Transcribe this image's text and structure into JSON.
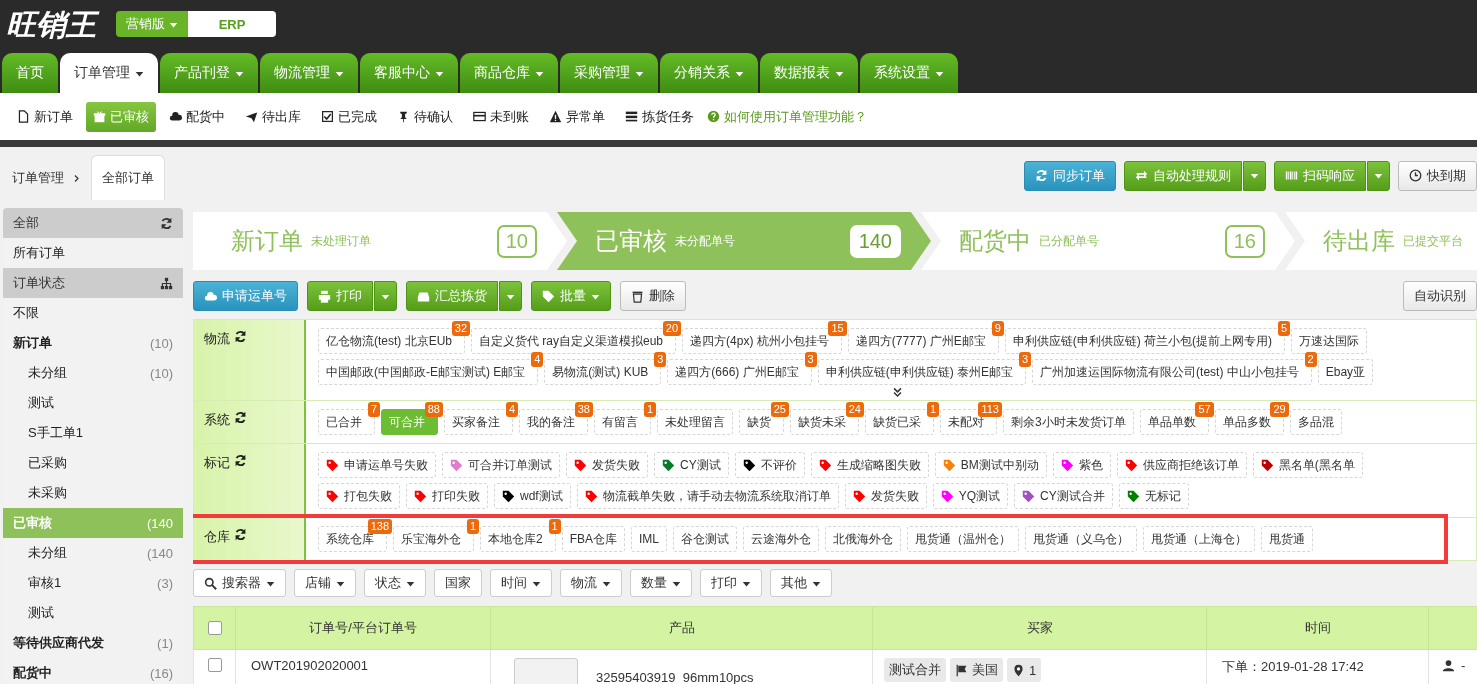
{
  "app": {
    "logo": "旺销王",
    "editions": [
      {
        "label": "营销版",
        "dropdown": true,
        "selected": false
      },
      {
        "label": "ERP",
        "dropdown": false,
        "selected": true
      }
    ]
  },
  "nav_tabs": [
    {
      "label": "首页",
      "dropdown": false,
      "selected": false
    },
    {
      "label": "订单管理",
      "dropdown": true,
      "selected": true
    },
    {
      "label": "产品刊登",
      "dropdown": true,
      "selected": false
    },
    {
      "label": "物流管理",
      "dropdown": true,
      "selected": false
    },
    {
      "label": "客服中心",
      "dropdown": true,
      "selected": false
    },
    {
      "label": "商品仓库",
      "dropdown": true,
      "selected": false
    },
    {
      "label": "采购管理",
      "dropdown": true,
      "selected": false
    },
    {
      "label": "分销关系",
      "dropdown": true,
      "selected": false
    },
    {
      "label": "数据报表",
      "dropdown": true,
      "selected": false
    },
    {
      "label": "系统设置",
      "dropdown": true,
      "selected": false
    }
  ],
  "sub_nav": {
    "items": [
      {
        "label": "新订单",
        "selected": false
      },
      {
        "label": "已审核",
        "selected": true
      },
      {
        "label": "配货中",
        "selected": false
      },
      {
        "label": "待出库",
        "selected": false
      },
      {
        "label": "已完成",
        "selected": false
      },
      {
        "label": "待确认",
        "selected": false
      },
      {
        "label": "未到账",
        "selected": false
      },
      {
        "label": "异常单",
        "selected": false
      },
      {
        "label": "拣货任务",
        "selected": false
      }
    ],
    "help_link": "如何使用订单管理功能？"
  },
  "breadcrumb": {
    "root": "订单管理",
    "tab": "全部订单"
  },
  "toolbar": [
    {
      "label": "同步订单",
      "kind": "info"
    },
    {
      "label": "自动处理规则",
      "kind": "split"
    },
    {
      "label": "扫码响应",
      "kind": "split"
    },
    {
      "label": "快到期",
      "kind": "plain"
    }
  ],
  "sidebar": {
    "sections": [
      {
        "title": "全部",
        "items": [
          {
            "label": "所有订单",
            "kind": "plain",
            "selected": false
          }
        ]
      },
      {
        "title": "订单状态",
        "items": [
          {
            "label": "不限",
            "kind": "plain",
            "selected": false
          },
          {
            "label": "新订单",
            "kind": "status",
            "count": "(10)",
            "selected": false,
            "children": [
              {
                "label": "未分组",
                "count": "(10)",
                "selected": false
              },
              {
                "label": "测试",
                "selected": false
              },
              {
                "label": "S手工单1",
                "selected": false
              },
              {
                "label": "已采购",
                "selected": false
              },
              {
                "label": "未采购",
                "selected": false
              }
            ]
          },
          {
            "label": "已审核",
            "kind": "status",
            "count": "(140",
            "selected": true,
            "children": [
              {
                "label": "未分组",
                "count": "(140",
                "selected": false
              },
              {
                "label": "审核1",
                "count": "(3)",
                "selected": false
              },
              {
                "label": "测试",
                "selected": false
              }
            ]
          },
          {
            "label": "等待供应商代发",
            "kind": "status",
            "count": "(1)",
            "selected": false
          },
          {
            "label": "配货中",
            "kind": "status",
            "count": "(16)",
            "selected": false
          }
        ]
      }
    ]
  },
  "pipeline": [
    {
      "title": "新订单",
      "subtitle": "未处理订单",
      "count": "10",
      "selected": false
    },
    {
      "title": "已审核",
      "subtitle": "未分配单号",
      "count": "140",
      "selected": true
    },
    {
      "title": "配货中",
      "subtitle": "已分配单号",
      "count": "16",
      "selected": false
    },
    {
      "title": "待出库",
      "subtitle": "已提交平台",
      "selected": false
    }
  ],
  "actions": [
    {
      "label": "申请运单号",
      "kind": "info"
    },
    {
      "label": "打印",
      "kind": "split"
    },
    {
      "label": "汇总拣货",
      "kind": "split"
    },
    {
      "label": "批量",
      "kind": "dropdown"
    },
    {
      "label": "删除",
      "kind": "plain"
    }
  ],
  "actions_right": "自动识别",
  "filters": [
    {
      "label": "物流",
      "kind": "chips",
      "expandable": true,
      "highlighted": false,
      "lines": [
        [
          {
            "label": "亿仓物流(test) 北京EUb",
            "count": "32",
            "selected": false
          },
          {
            "label": "自定义货代 ray自定义渠道模拟eub",
            "count": "20",
            "selected": false
          },
          {
            "label": "递四方(4px) 杭州小包挂号",
            "count": "15",
            "selected": false
          },
          {
            "label": "递四方(7777) 广州E邮宝",
            "count": "9",
            "selected": false
          },
          {
            "label": "申利供应链(申利供应链) 荷兰小包(提前上网专用)",
            "count": "5",
            "selected": false
          },
          {
            "label": "万速达国际",
            "selected": false
          }
        ],
        [
          {
            "label": "中国邮政(中国邮政-E邮宝测试) E邮宝",
            "count": "4",
            "selected": false
          },
          {
            "label": "易物流(测试) KUB",
            "count": "3",
            "selected": false
          },
          {
            "label": "递四方(666) 广州E邮宝",
            "count": "3",
            "selected": false
          },
          {
            "label": "申利供应链(申利供应链) 泰州E邮宝",
            "count": "3",
            "selected": false
          },
          {
            "label": "广州加速运国际物流有限公司(test) 中山小包挂号",
            "count": "2",
            "selected": false
          },
          {
            "label": "Ebay亚",
            "selected": false
          }
        ]
      ]
    },
    {
      "label": "系统",
      "kind": "chips",
      "expandable": false,
      "highlighted": false,
      "lines": [
        [
          {
            "label": "已合并",
            "count": "7",
            "selected": false
          },
          {
            "label": "可合并",
            "count": "88",
            "selected": true
          },
          {
            "label": "买家备注",
            "count": "4",
            "selected": false
          },
          {
            "label": "我的备注",
            "count": "38",
            "selected": false
          },
          {
            "label": "有留言",
            "count": "1",
            "selected": false
          },
          {
            "label": "未处理留言",
            "selected": false
          },
          {
            "label": "缺货",
            "count": "25",
            "selected": false
          },
          {
            "label": "缺货未采",
            "count": "24",
            "selected": false
          },
          {
            "label": "缺货已采",
            "count": "1",
            "selected": false
          },
          {
            "label": "未配对",
            "count": "113",
            "selected": false
          },
          {
            "label": "剩余3小时未发货订单",
            "selected": false
          },
          {
            "label": "单品单数",
            "count": "57",
            "selected": false
          },
          {
            "label": "单品多数",
            "count": "29",
            "selected": false
          },
          {
            "label": "多品混",
            "selected": false
          }
        ]
      ]
    },
    {
      "label": "标记",
      "kind": "tags",
      "expandable": false,
      "highlighted": false,
      "lines": [
        [
          {
            "label": "申请运单号失败",
            "color": "#ff0000",
            "selected": false
          },
          {
            "label": "可合并订单测试",
            "color": "#e07bd0",
            "selected": false
          },
          {
            "label": "发货失败",
            "color": "#ff0000",
            "selected": false
          },
          {
            "label": "CY测试",
            "color": "#0a7a2a",
            "selected": false
          },
          {
            "label": "不评价",
            "color": "#000000",
            "selected": false
          },
          {
            "label": "生成缩略图失败",
            "color": "#ff0000",
            "selected": false
          },
          {
            "label": "BM测试中别动",
            "color": "#ff7f00",
            "selected": false
          },
          {
            "label": "紫色",
            "color": "#ff00ff",
            "selected": false
          },
          {
            "label": "供应商拒绝该订单",
            "color": "#ff0000",
            "selected": false
          },
          {
            "label": "黑名单(黑名单",
            "color": "#c00000",
            "selected": false
          }
        ],
        [
          {
            "label": "打包失败",
            "color": "#ff0000",
            "selected": false
          },
          {
            "label": "打印失败",
            "color": "#ff0000",
            "selected": false
          },
          {
            "label": "wdf测试",
            "color": "#000000",
            "selected": false
          },
          {
            "label": "物流截单失败，请手动去物流系统取消订单",
            "color": "#ff0000",
            "selected": false
          },
          {
            "label": "发货失败",
            "color": "#ff0000",
            "selected": false
          },
          {
            "label": "YQ测试",
            "color": "#ff00ff",
            "selected": false
          },
          {
            "label": "CY测试合并",
            "color": "#a050c0",
            "selected": false
          },
          {
            "label": "无标记",
            "color": "#008000",
            "selected": false
          }
        ]
      ]
    },
    {
      "label": "仓库",
      "kind": "chips",
      "expandable": false,
      "highlighted": true,
      "lines": [
        [
          {
            "label": "系统仓库",
            "count": "138",
            "selected": false
          },
          {
            "label": "乐宝海外仓",
            "count": "1",
            "selected": false
          },
          {
            "label": "本地仓库2",
            "count": "1",
            "selected": false
          },
          {
            "label": "FBA仓库",
            "selected": false
          },
          {
            "label": "IML",
            "selected": false
          },
          {
            "label": "谷仓测试",
            "selected": false
          },
          {
            "label": "云途海外仓",
            "selected": false
          },
          {
            "label": "北俄海外仓",
            "selected": false
          },
          {
            "label": "甩货通（温州仓）",
            "selected": false
          },
          {
            "label": "甩货通（义乌仓）",
            "selected": false
          },
          {
            "label": "甩货通（上海仓）",
            "selected": false
          },
          {
            "label": "甩货通",
            "selected": false
          }
        ]
      ]
    }
  ],
  "filter_bar": [
    {
      "label": "搜索器",
      "dropdown": true
    },
    {
      "label": "店铺",
      "dropdown": true
    },
    {
      "label": "状态",
      "dropdown": true
    },
    {
      "label": "国家",
      "dropdown": false
    },
    {
      "label": "时间",
      "dropdown": true
    },
    {
      "label": "物流",
      "dropdown": true
    },
    {
      "label": "数量",
      "dropdown": true
    },
    {
      "label": "打印",
      "dropdown": true
    },
    {
      "label": "其他",
      "dropdown": true
    }
  ],
  "table": {
    "select_all_checked": false,
    "columns": [
      "订单号/平台订单号",
      "产品",
      "买家",
      "时间"
    ],
    "rows": [
      {
        "checked": false,
        "order_no": "OWT201902020001",
        "product": "32595403919_96mm10pcs",
        "buyer_tag": "测试合并",
        "country": "美国",
        "buyer_count": "1",
        "time": "下单：2019-01-28 17:42",
        "assignee": "-"
      }
    ]
  }
}
